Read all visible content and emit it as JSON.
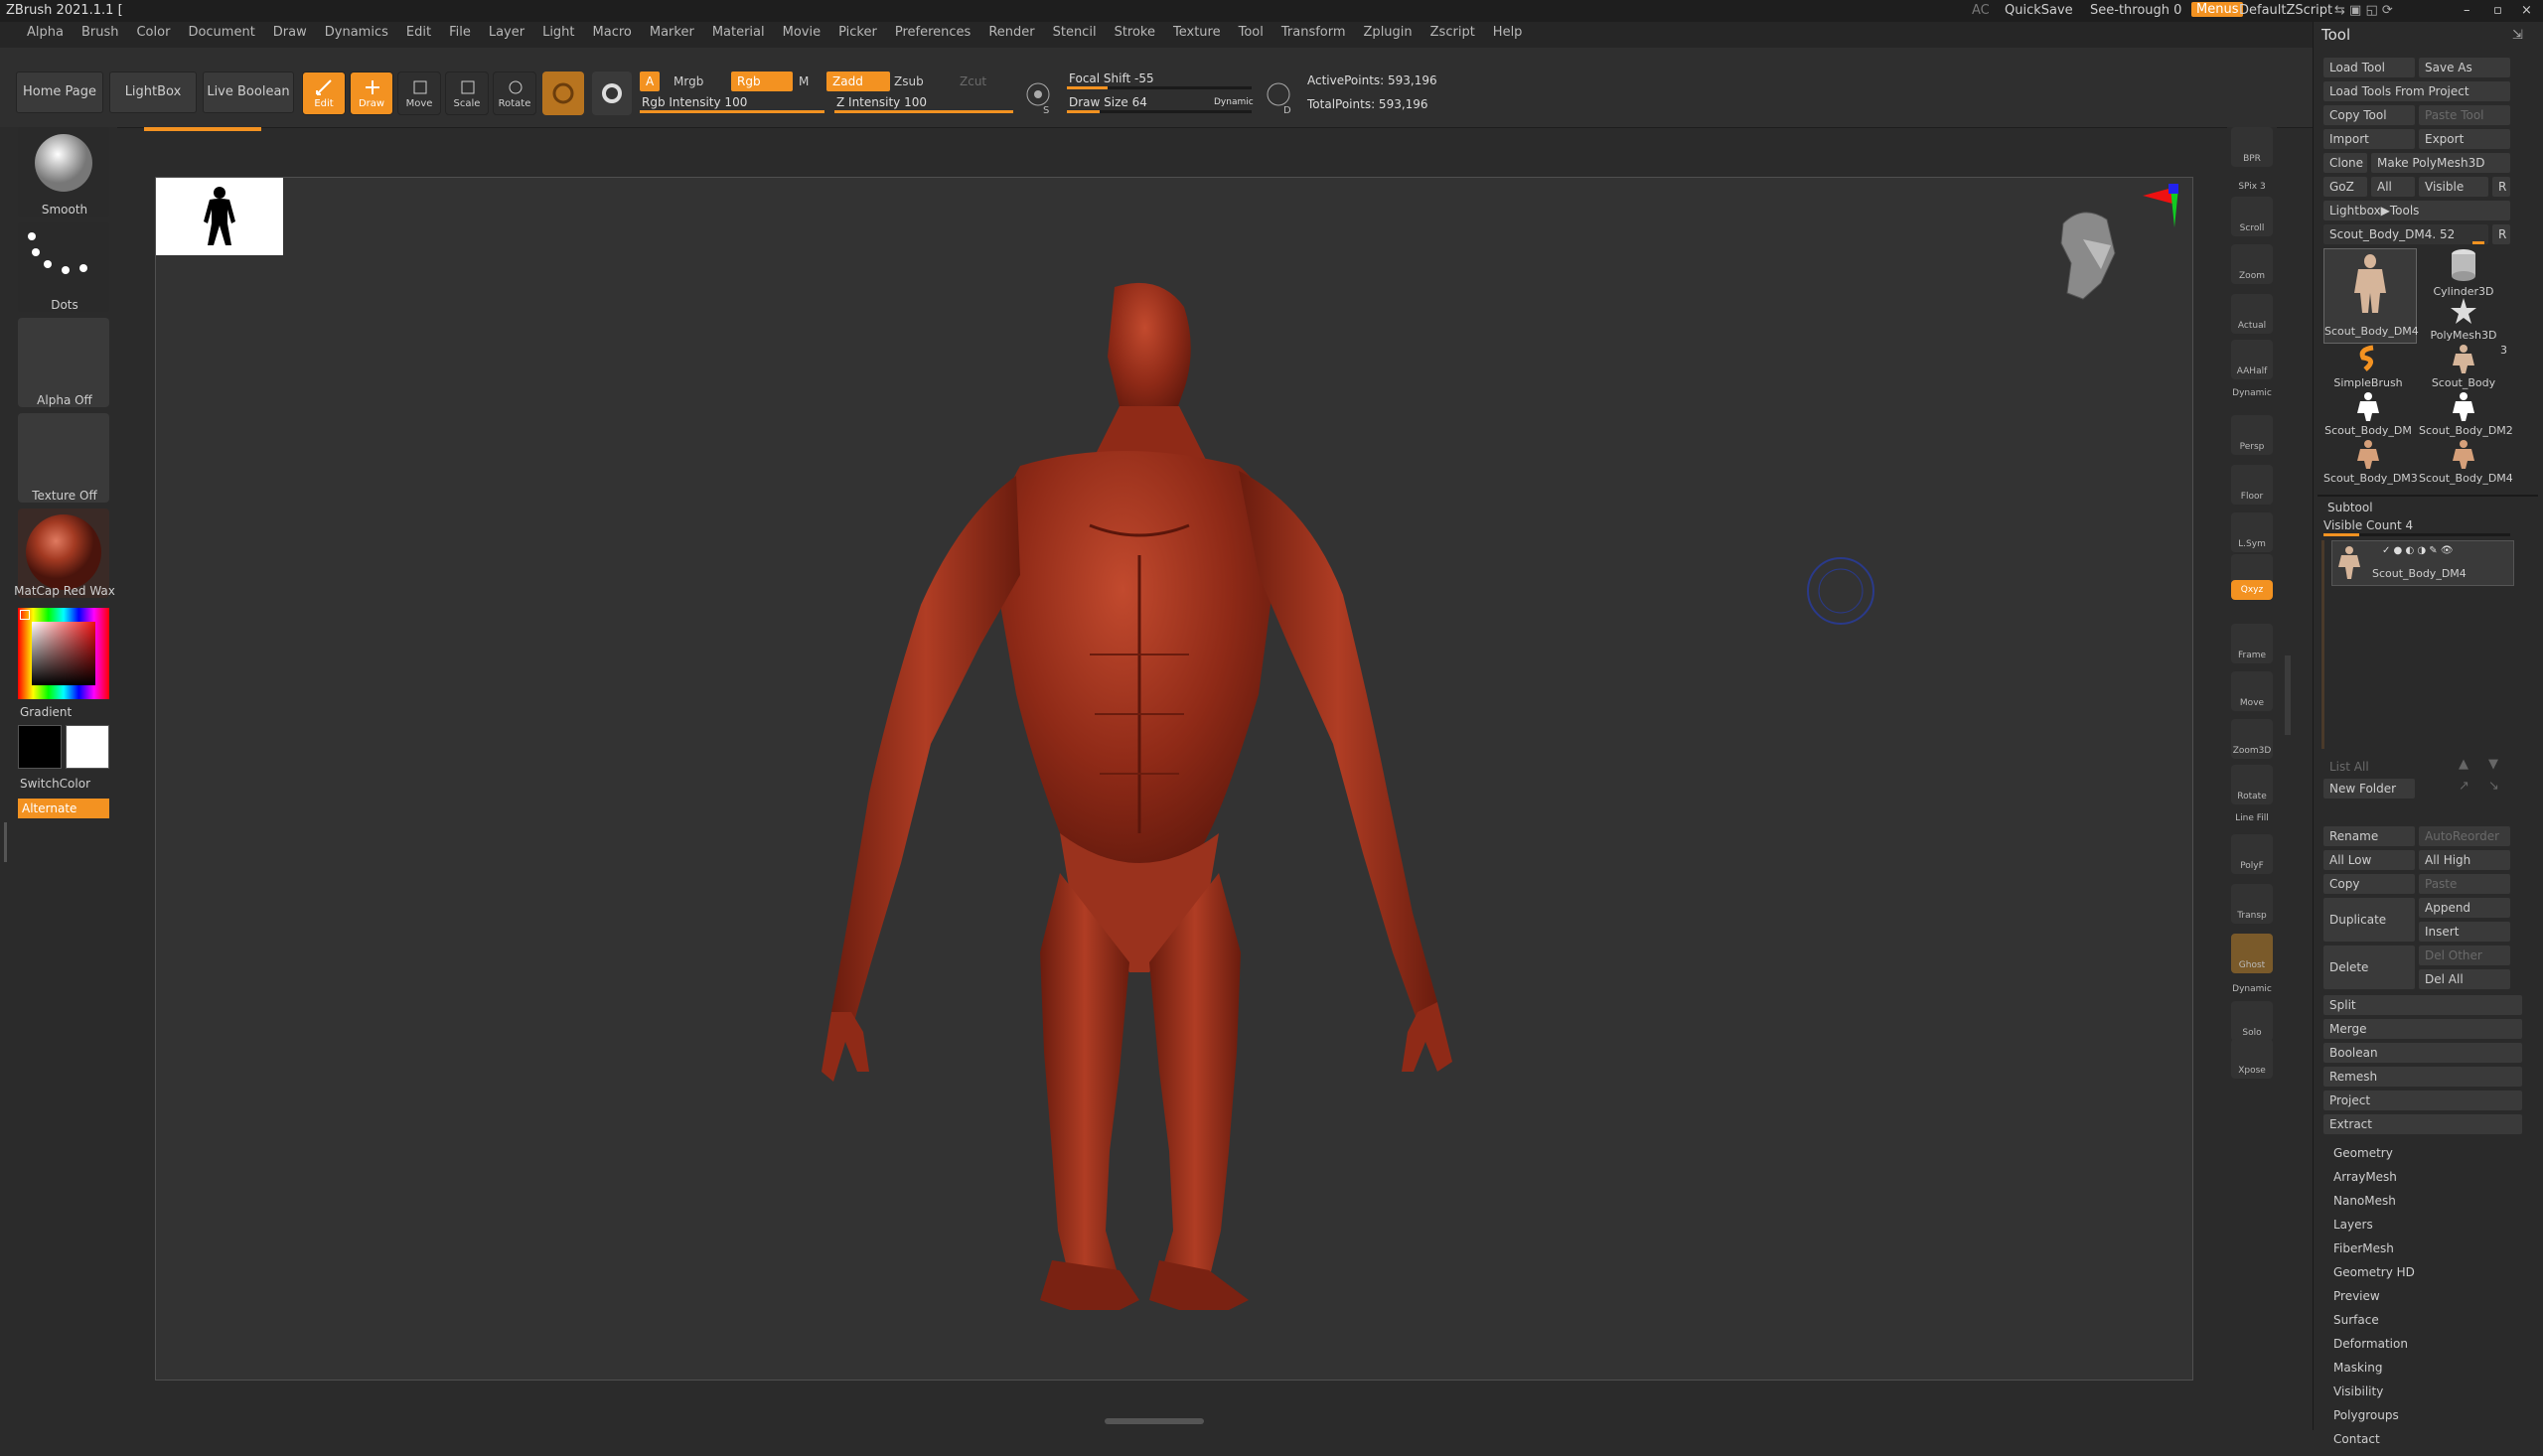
{
  "app": {
    "title": "ZBrush 2021.1.1 [",
    "menus": [
      "Alpha",
      "Brush",
      "Color",
      "Document",
      "Draw",
      "Dynamics",
      "Edit",
      "File",
      "Layer",
      "Light",
      "Macro",
      "Marker",
      "Material",
      "Movie",
      "Picker",
      "Preferences",
      "Render",
      "Stencil",
      "Stroke",
      "Texture",
      "Tool",
      "Transform",
      "Zplugin",
      "Zscript",
      "Help"
    ],
    "top_right": {
      "ac": "AC",
      "quicksave": "QuickSave",
      "see_through": "See-through",
      "see_through_value": "0",
      "menus": "Menus",
      "script": "DefaultZScript"
    }
  },
  "shelf": {
    "home_page": "Home Page",
    "lightbox": "LightBox",
    "live_boolean": "Live Boolean",
    "edit": "Edit",
    "draw": "Draw",
    "move": "Move",
    "scale": "Scale",
    "rotate": "Rotate",
    "a": "A",
    "mrgb": "Mrgb",
    "rgb": "Rgb",
    "m": "M",
    "zadd": "Zadd",
    "zsub": "Zsub",
    "zcut": "Zcut",
    "rgb_intensity": "Rgb Intensity 100",
    "z_intensity": "Z Intensity 100",
    "focal_shift": "Focal Shift -55",
    "draw_size": "Draw Size 64",
    "dynamic": "Dynamic",
    "active_points": "ActivePoints: 593,196",
    "total_points": "TotalPoints: 593,196",
    "s_label": "S",
    "d_label": "D"
  },
  "left": {
    "brush": "Smooth",
    "stroke": "Dots",
    "alpha": "Alpha Off",
    "texture": "Texture Off",
    "material": "MatCap Red Wax",
    "gradient": "Gradient",
    "switch_color": "SwitchColor",
    "alternate": "Alternate",
    "colors": {
      "main": "#000000",
      "secondary": "#ffffff",
      "accent": "#f39221"
    }
  },
  "right_toolbar": [
    "BPR",
    "SPix 3",
    "Scroll",
    "Zoom",
    "Actual",
    "AAHalf",
    "Dynamic",
    "Persp",
    "Floor",
    "L.Sym",
    "Lock",
    "Qxyz",
    "Frame",
    "Move",
    "Zoom3D",
    "Rotate",
    "Line Fill",
    "PolyF",
    "Transp",
    "Ghost",
    "Dynamic",
    "Solo",
    "Xpose"
  ],
  "tool_panel": {
    "title": "Tool",
    "load_tool": "Load Tool",
    "save_as": "Save As",
    "load_from_project": "Load Tools From Project",
    "copy_tool": "Copy Tool",
    "paste_tool": "Paste Tool",
    "import": "Import",
    "export": "Export",
    "clone": "Clone",
    "make_polymesh": "Make PolyMesh3D",
    "goz": "GoZ",
    "all": "All",
    "visible": "Visible",
    "r": "R",
    "lightbox_tools": "Lightbox▶Tools",
    "current_tool": "Scout_Body_DM4. 52",
    "tools": [
      "Scout_Body_DM4",
      "Cylinder3D",
      "PolyMesh3D",
      "SimpleBrush",
      "Scout_Body",
      "Scout_Body_DM",
      "Scout_Body_DM2",
      "Scout_Body_DM3",
      "Scout_Body_DM4"
    ],
    "tool_count_badge": "3",
    "subtool": "Subtool",
    "visible_count": "Visible Count 4",
    "subtool_name": "Scout_Body_DM4",
    "list_all": "List All",
    "new_folder": "New Folder",
    "rename": "Rename",
    "auto_reorder": "AutoReorder",
    "all_low": "All Low",
    "all_high": "All High",
    "copy": "Copy",
    "paste": "Paste",
    "duplicate": "Duplicate",
    "append": "Append",
    "insert": "Insert",
    "delete": "Delete",
    "del_other": "Del Other",
    "del_all": "Del All",
    "actions": [
      "Split",
      "Merge",
      "Boolean",
      "Remesh",
      "Project",
      "Extract"
    ],
    "sections": [
      "Geometry",
      "ArrayMesh",
      "NanoMesh",
      "Layers",
      "FiberMesh",
      "Geometry HD",
      "Preview",
      "Surface",
      "Deformation",
      "Masking",
      "Visibility",
      "Polygroups",
      "Contact"
    ]
  }
}
